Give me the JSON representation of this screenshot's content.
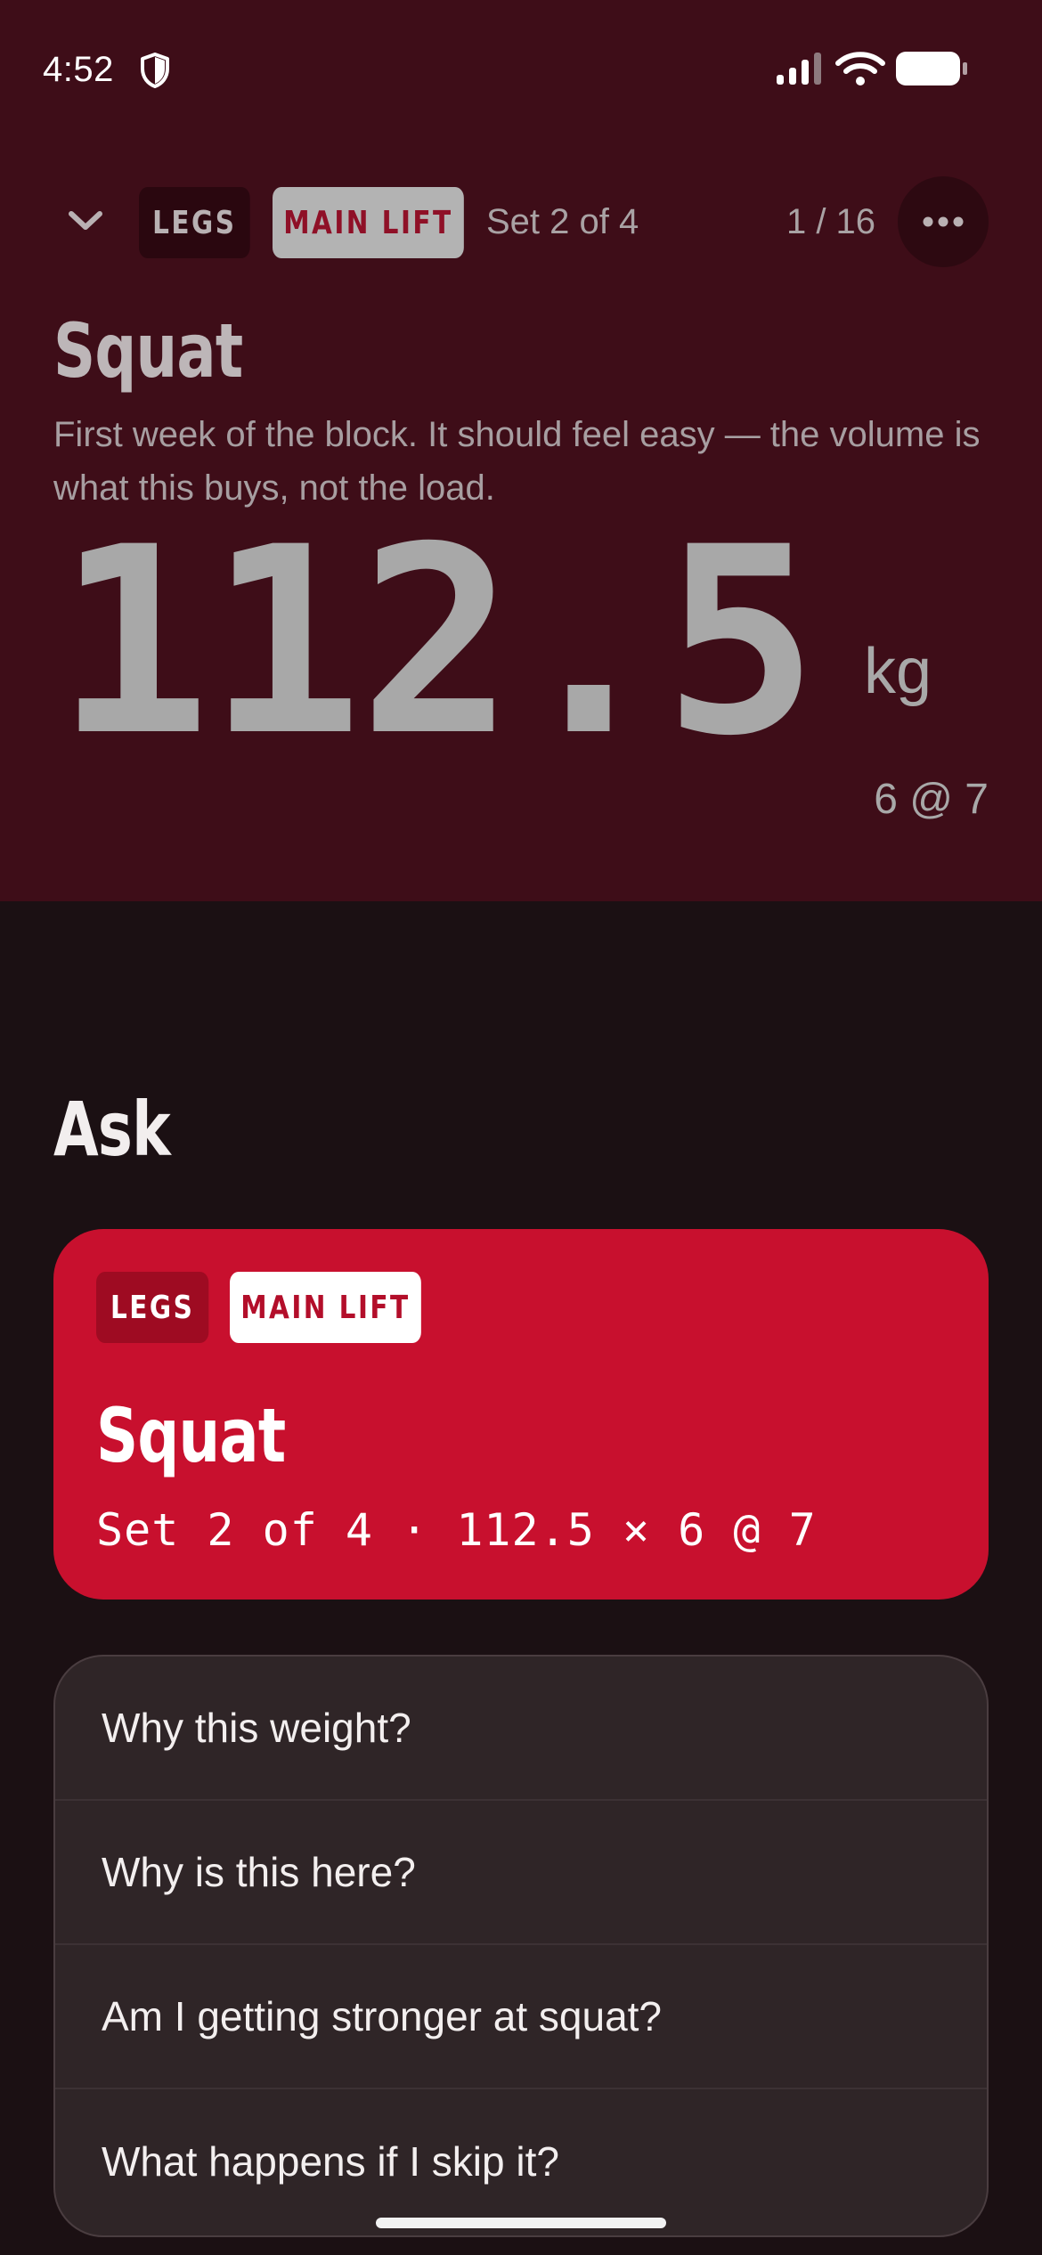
{
  "status_bar": {
    "time": "4:52",
    "icons": [
      "shield-icon",
      "cellular-signal-icon",
      "wifi-icon",
      "battery-icon"
    ]
  },
  "header": {
    "collapse_icon": "chevron-down-icon",
    "tag_category": "LEGS",
    "tag_type": "MAIN LIFT",
    "set_label": "Set 2 of 4",
    "counter": "1 / 16",
    "more_icon": "more-horizontal-icon"
  },
  "exercise": {
    "name": "Squat",
    "note": "First week of the block. It should feel easy — the volume is what this buys, not the load.",
    "weight": "112.5",
    "unit": "kg",
    "reps_rpe": "6 @ 7"
  },
  "ask": {
    "heading": "Ask",
    "card": {
      "tag_category": "LEGS",
      "tag_type": "MAIN LIFT",
      "title": "Squat",
      "detail": "Set 2 of 4 · 112.5 × 6 @ 7"
    },
    "questions": [
      "Why this weight?",
      "Why is this here?",
      "Am I getting stronger at squat?",
      "What happens if I skip it?"
    ]
  },
  "colors": {
    "top_background": "#3e0d18",
    "screen_background": "#1b1013",
    "accent_red": "#c8102e",
    "question_card": "#2f2527"
  }
}
